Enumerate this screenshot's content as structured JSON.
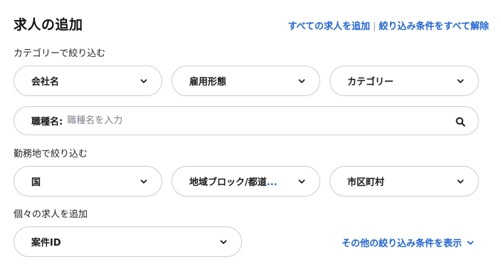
{
  "header": {
    "title": "求人の追加",
    "link_add_all": "すべての求人を追加",
    "separator": "|",
    "link_clear_all": "絞り込み条件をすべて解除"
  },
  "category_filter": {
    "label": "カテゴリーで絞り込む",
    "dropdowns": [
      {
        "label": "会社名",
        "icon": "chevron-down-icon"
      },
      {
        "label": "雇用形態",
        "icon": "chevron-down-icon"
      },
      {
        "label": "カテゴリー",
        "icon": "chevron-down-icon"
      }
    ],
    "job_title_field": {
      "label": "職種名:",
      "placeholder": "職種名を入力",
      "value": "",
      "icon": "search-icon"
    }
  },
  "location_filter": {
    "label": "勤務地で絞り込む",
    "dropdowns": [
      {
        "label": "国",
        "icon": "chevron-down-icon"
      },
      {
        "label": "地域ブロック/都道",
        "ellipsis": "...",
        "icon": "chevron-down-icon"
      },
      {
        "label": "市区町村",
        "icon": "chevron-down-icon"
      }
    ]
  },
  "individual": {
    "label": "個々の求人を追加",
    "dropdown": {
      "label": "案件ID",
      "icon": "chevron-down-icon"
    },
    "more_filters_link": "その他の絞り込み条件を表示"
  },
  "colors": {
    "link": "#1d63d8",
    "border": "#c9ccd1",
    "text": "#1a1a1a"
  }
}
